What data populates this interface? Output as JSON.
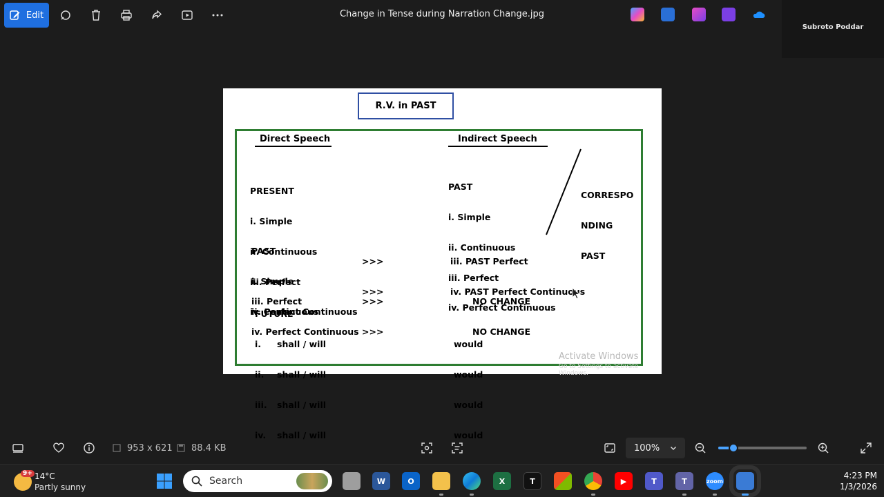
{
  "toolbar": {
    "edit_label": "Edit",
    "file_title": "Change in Tense during Narration Change.jpg",
    "user_name": "Subroto Poddar"
  },
  "image": {
    "box_title": "R.V. in PAST",
    "direct_header": "Direct Speech",
    "indirect_header": "Indirect Speech",
    "present_block": [
      "PRESENT",
      "i. Simple",
      "ii. Continuous",
      "iii. Perfect",
      "iv. Perfect Continuous"
    ],
    "past_right_block": [
      "PAST",
      "i. Simple",
      "ii. Continuous",
      "iii. Perfect",
      "iv. Perfect Continuous"
    ],
    "corresponding_label": [
      "CORRESPO",
      "NDING",
      "PAST"
    ],
    "past_left_block": [
      "PAST",
      "i. Simple",
      "ii. Continuous"
    ],
    "arrows_1": [
      ">>>",
      ">>>"
    ],
    "past_result": [
      "iii. PAST Perfect",
      "iv. PAST Perfect Continuous"
    ],
    "perfect_left": [
      "iii. Perfect",
      "iv. Perfect Continuous"
    ],
    "arrows_2": [
      ">>>",
      ">>>"
    ],
    "no_change": [
      "NO CHANGE",
      "NO CHANGE"
    ],
    "future_header": "FUTURE",
    "future_rows": [
      {
        "num": "i.",
        "val": "shall / will",
        "result": "would"
      },
      {
        "num": "ii.",
        "val": "shall / will",
        "result": "would"
      },
      {
        "num": "iii.",
        "val": "shall / will",
        "result": "would"
      },
      {
        "num": "iv.",
        "val": "shall / will",
        "result": "would"
      }
    ],
    "watermark_line1": "Activate Windows",
    "watermark_line2": "Go to Settings to activate Windows."
  },
  "bottom": {
    "dimensions": "953 x 621",
    "file_size": "88.4 KB",
    "zoom": "100%",
    "zoom_slider_fraction": 0.17
  },
  "taskbar": {
    "temperature": "14°C",
    "condition": "Partly sunny",
    "weather_badge": "9+",
    "search_placeholder": "Search",
    "time": "4:23 PM",
    "date": "1/3/2026"
  }
}
